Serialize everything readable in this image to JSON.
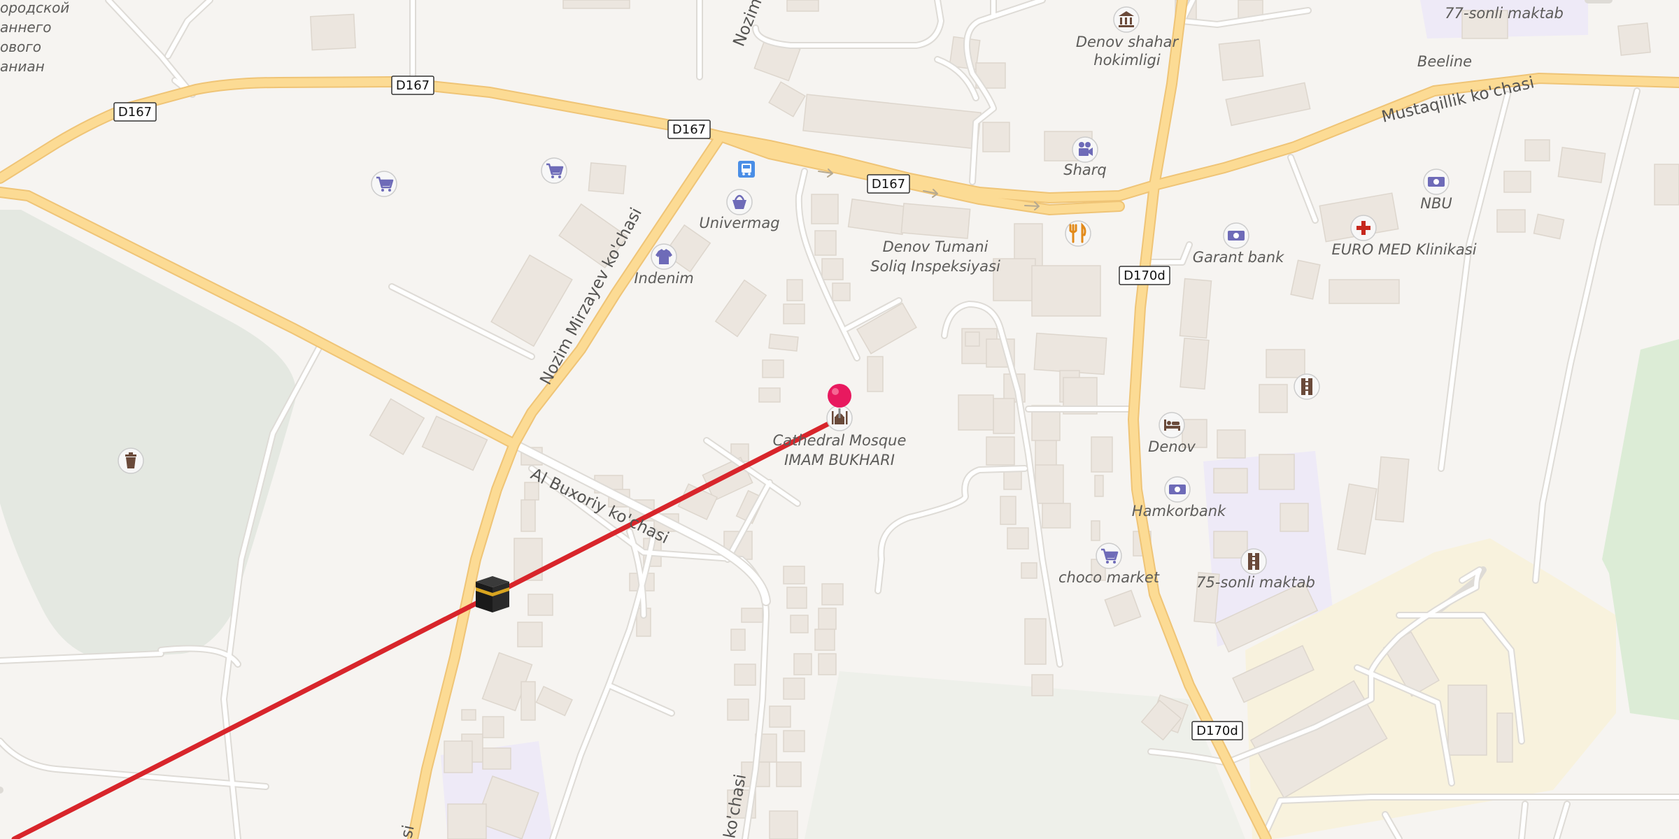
{
  "map": {
    "colors": {
      "background": "#f6f4f1",
      "park": "#e4e8e1",
      "school": "#eeeaf7",
      "cemetery_area": "#f8f2dd",
      "forest_green": "#dcecd6",
      "building": "#ece6df",
      "major_road": "#fcdb94",
      "major_road_casing": "#efc476",
      "minor_road": "#ffffff",
      "minor_road_casing": "#dedbd6",
      "route_line": "#d8252b",
      "pin": "#e8195f",
      "poi_icon_blue": "#6e6bb8"
    },
    "road_shields": [
      {
        "id": "d167-1",
        "text": "D167"
      },
      {
        "id": "d167-2",
        "text": "D167"
      },
      {
        "id": "d167-3",
        "text": "D167"
      },
      {
        "id": "d167-4",
        "text": "D167"
      },
      {
        "id": "d170d-1",
        "text": "D170d"
      },
      {
        "id": "d170d-2",
        "text": "D170d"
      }
    ],
    "street_labels": {
      "nozim_mirzayev": "Nozim Mirzayev ko'chasi",
      "nozim_top": "Nozim",
      "al_buxoriy": "Al Buxoriy ko'chasi",
      "mustaqillik": "Mustaqillik ko'chasi",
      "bottom_kochasi": "ko'chasi",
      "bottom_left_partial": "si"
    },
    "pois": [
      {
        "id": "denov-hokimligi",
        "icon": "government-building-icon",
        "label_lines": [
          "Denov shahar",
          "hokimligi"
        ]
      },
      {
        "id": "77-sonli-maktab",
        "icon": "school-icon",
        "label_lines": [
          "77-sonli maktab"
        ]
      },
      {
        "id": "beeline",
        "icon": "phone-shop-icon",
        "label_lines": [
          "Beeline"
        ]
      },
      {
        "id": "sharq",
        "icon": "cinema-icon",
        "label_lines": [
          "Sharq"
        ]
      },
      {
        "id": "nbu",
        "icon": "bank-icon",
        "label_lines": [
          "NBU"
        ]
      },
      {
        "id": "univermag",
        "icon": "shopping-basket-icon",
        "label_lines": [
          "Univermag"
        ]
      },
      {
        "id": "bus-stop",
        "icon": "bus-stop-icon",
        "label_lines": []
      },
      {
        "id": "restaurant",
        "icon": "restaurant-icon",
        "label_lines": []
      },
      {
        "id": "soliq-inspeksiyasi",
        "icon": "none",
        "label_lines": [
          "Denov Tumani",
          "Soliq Inspeksiyasi"
        ]
      },
      {
        "id": "garant-bank",
        "icon": "bank-icon",
        "label_lines": [
          "Garant bank"
        ]
      },
      {
        "id": "euro-med",
        "icon": "clinic-cross-icon",
        "label_lines": [
          "EURO MED Klinikasi"
        ]
      },
      {
        "id": "indenim",
        "icon": "clothes-shop-icon",
        "label_lines": [
          "Indenim"
        ]
      },
      {
        "id": "cathedral-mosque",
        "icon": "mosque-icon",
        "label_lines": [
          "Cathedral Mosque",
          "IMAM BUKHARI"
        ]
      },
      {
        "id": "denov-hotel",
        "icon": "hotel-bed-icon",
        "label_lines": [
          "Denov"
        ]
      },
      {
        "id": "hamkorbank",
        "icon": "bank-icon",
        "label_lines": [
          "Hamkorbank"
        ]
      },
      {
        "id": "choco-market",
        "icon": "shopping-cart-icon",
        "label_lines": [
          "choco market"
        ]
      },
      {
        "id": "75-sonli-maktab",
        "icon": "school-ruler-icon",
        "label_lines": [
          "75-sonli maktab"
        ]
      },
      {
        "id": "school-ruler-unnamed",
        "icon": "school-ruler-icon",
        "label_lines": []
      },
      {
        "id": "cart-1",
        "icon": "shopping-cart-icon",
        "label_lines": []
      },
      {
        "id": "cart-2",
        "icon": "shopping-cart-icon",
        "label_lines": []
      },
      {
        "id": "waste-bin",
        "icon": "waste-basket-icon",
        "label_lines": []
      }
    ],
    "partial_labels": {
      "cyrillic": [
        "ородской",
        "аннего",
        "ового",
        "аниан"
      ]
    },
    "markers": {
      "destination_pin": "location-pin-icon",
      "kaaba": "kaaba-icon"
    }
  }
}
